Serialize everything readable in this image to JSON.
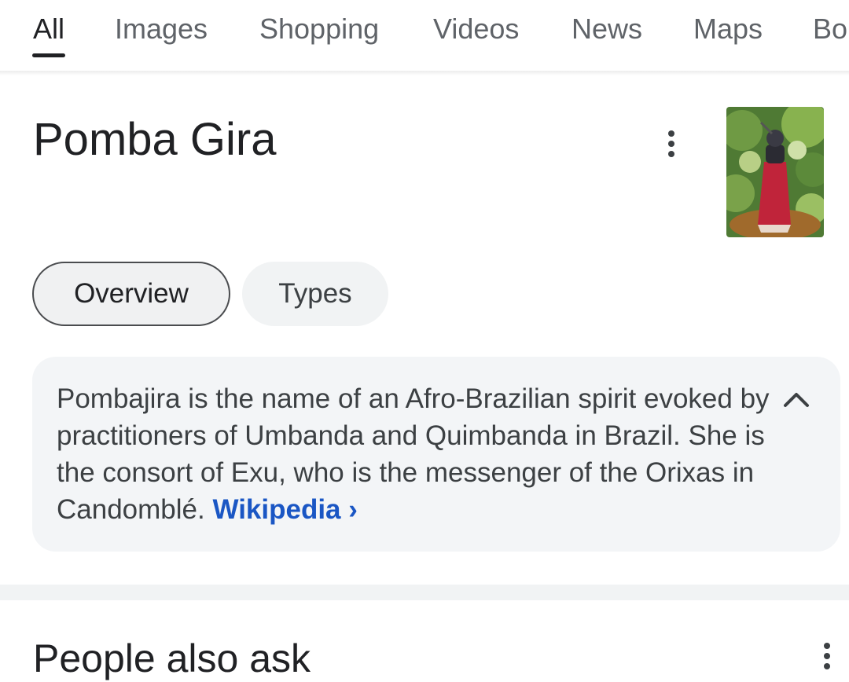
{
  "tabs": [
    {
      "label": "All",
      "active": true
    },
    {
      "label": "Images"
    },
    {
      "label": "Shopping"
    },
    {
      "label": "Videos"
    },
    {
      "label": "News"
    },
    {
      "label": "Maps"
    },
    {
      "label": "Bo"
    }
  ],
  "entity": {
    "title": "Pomba Gira",
    "menu_icon": "more-vert-icon",
    "thumbnail_alt": "Photo of a figure in a red dress among green foliage"
  },
  "chips": [
    {
      "label": "Overview",
      "selected": true
    },
    {
      "label": "Types",
      "selected": false
    }
  ],
  "description": {
    "text": "Pombajira is the name of an Afro-Brazilian spirit evoked by practitioners of Umbanda and Quimbanda in Brazil. She is the consort of Exu, who is the messenger of the Orixas in Candomblé.",
    "source_link": "Wikipedia",
    "source_chevron": "›",
    "collapse_icon": "chevron-up-icon"
  },
  "people_also_ask": {
    "heading": "People also ask",
    "menu_icon": "more-vert-icon"
  },
  "colors": {
    "link": "#1a56c4",
    "text_primary": "#202124",
    "text_secondary": "#5f6368",
    "card_bg": "#f3f5f7",
    "chip_bg": "#f1f3f4"
  }
}
